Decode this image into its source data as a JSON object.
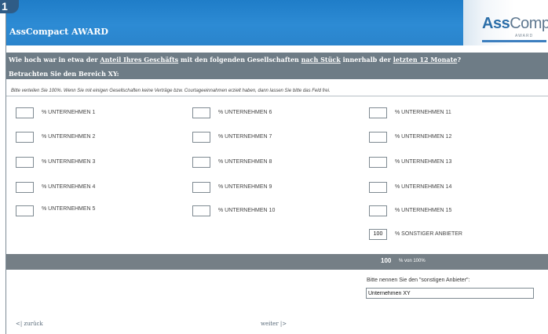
{
  "step_badge": "1",
  "header": {
    "title": "AssCompact AWARD",
    "logo_ass": "Ass",
    "logo_compact": "Compact",
    "logo_sub": "AWARD"
  },
  "question": {
    "part1": "Wie hoch war in etwa der ",
    "link1": "Anteil Ihres Geschäfts",
    "part2": " mit den folgenden Gesellschaften ",
    "link2": "nach Stück",
    "part3": " innerhalb der ",
    "link3": "letzten 12 Monate",
    "part4": "?",
    "line2": "Betrachten Sie den Bereich XY:"
  },
  "instruction": "Bitte verteilen Sie 100%. Wenn Sie mit einigen Gesellschaften keine Verträge bzw. Courtageeinnahmen erzielt haben, dann lassen Sie bitte das Feld frei.",
  "companies": [
    {
      "label": "% UNTERNEHMEN 1",
      "value": ""
    },
    {
      "label": "% UNTERNEHMEN 2",
      "value": ""
    },
    {
      "label": "% UNTERNEHMEN 3",
      "value": ""
    },
    {
      "label": "% UNTERNEHMEN 4",
      "value": ""
    },
    {
      "label": "% UNTERNEHMEN 5",
      "value": ""
    },
    {
      "label": "% UNTERNEHMEN 6",
      "value": ""
    },
    {
      "label": "% UNTERNEHMEN 7",
      "value": ""
    },
    {
      "label": "% UNTERNEHMEN 8",
      "value": ""
    },
    {
      "label": "% UNTERNEHMEN 9",
      "value": ""
    },
    {
      "label": "% UNTERNEHMEN 10",
      "value": ""
    },
    {
      "label": "% UNTERNEHMEN 11",
      "value": ""
    },
    {
      "label": "% UNTERNEHMEN 12",
      "value": ""
    },
    {
      "label": "% UNTERNEHMEN 13",
      "value": ""
    },
    {
      "label": "% UNTERNEHMEN 14",
      "value": ""
    },
    {
      "label": "% UNTERNEHMEN 15",
      "value": ""
    },
    {
      "label": "% SONSTIGER ANBIETER",
      "value": "100"
    }
  ],
  "sum": {
    "value": "100",
    "unit": "% von 100%"
  },
  "other_provider": {
    "label": "Bitte nennen Sie den \"sonstigen Anbieter\":",
    "value": "Unternehmen XY"
  },
  "nav": {
    "back": "<| zurück",
    "next": "weiter |>"
  },
  "colors": {
    "header_blue": "#2a84cc",
    "bar_gray": "#6e7c86",
    "sum_gray": "#757f86"
  }
}
